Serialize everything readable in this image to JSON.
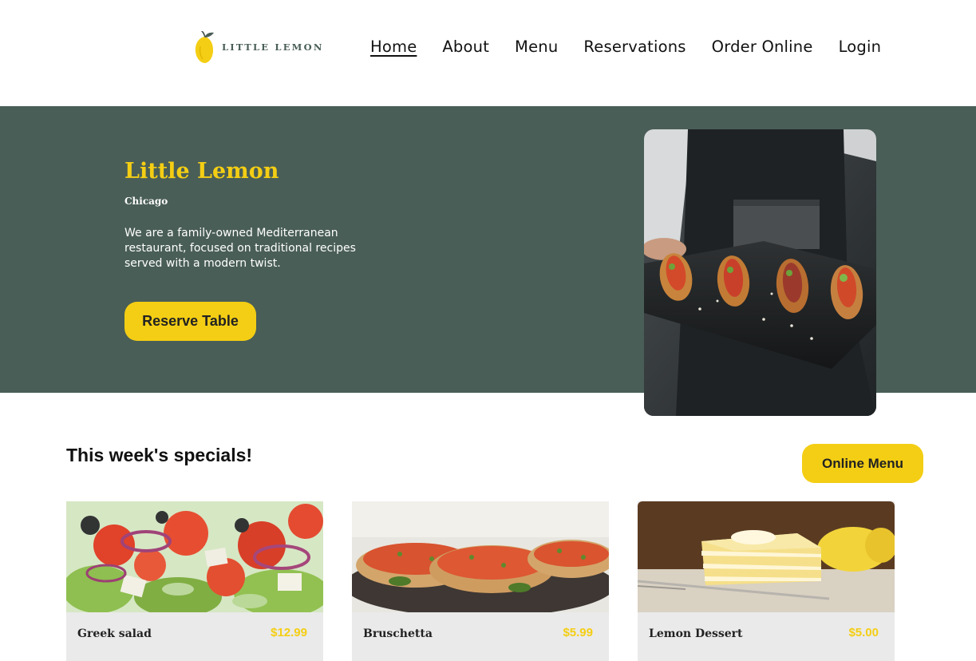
{
  "header": {
    "logo_text": "LITTLE LEMON",
    "nav": [
      {
        "label": "Home",
        "active": true
      },
      {
        "label": "About"
      },
      {
        "label": "Menu"
      },
      {
        "label": "Reservations"
      },
      {
        "label": "Order Online"
      },
      {
        "label": "Login"
      }
    ]
  },
  "hero": {
    "title": "Little Lemon",
    "subtitle": "Chicago",
    "description": "We are a family-owned Mediterranean restaurant, focused on traditional recipes served with a modern twist.",
    "button_label": "Reserve Table"
  },
  "specials": {
    "title": "This week's specials!",
    "button_label": "Online Menu",
    "items": [
      {
        "name": "Greek salad",
        "price": "$12.99"
      },
      {
        "name": "Bruschetta",
        "price": "$5.99"
      },
      {
        "name": "Lemon Dessert",
        "price": "$5.00"
      }
    ]
  },
  "colors": {
    "primary_green": "#495e57",
    "primary_yellow": "#f4ce14",
    "card_bg": "#eaeaea"
  }
}
